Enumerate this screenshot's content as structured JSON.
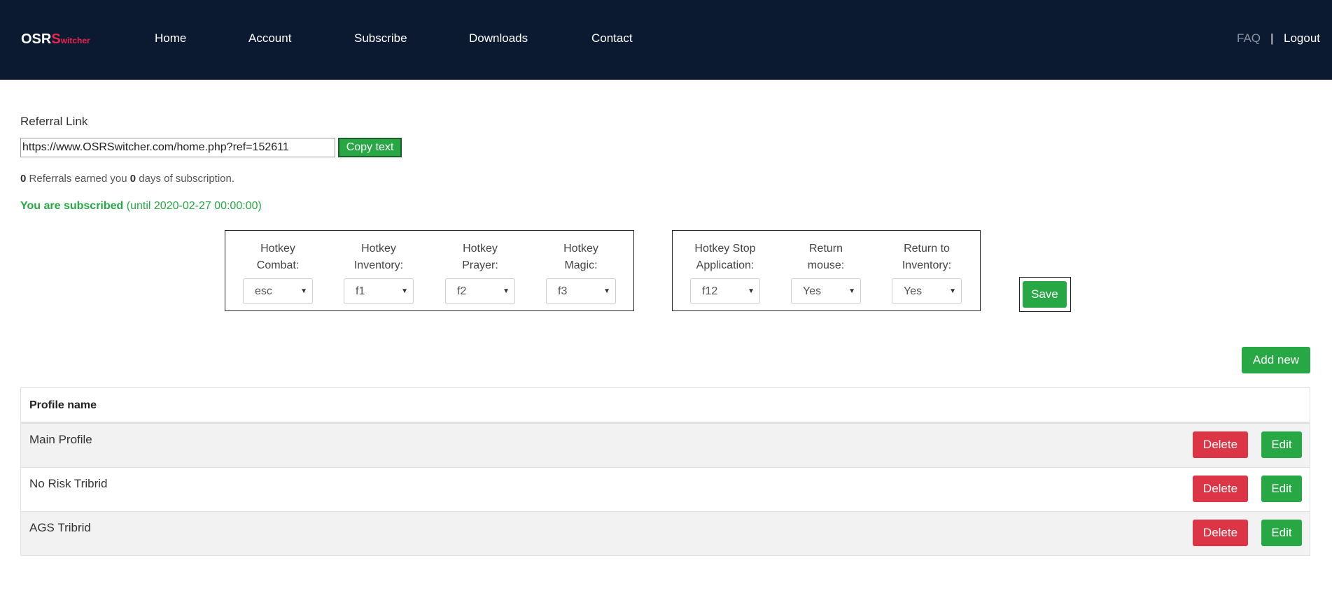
{
  "nav": {
    "logo_osr": "OSR",
    "logo_s": "S",
    "logo_witcher": "witcher",
    "links": [
      "Home",
      "Account",
      "Subscribe",
      "Downloads",
      "Contact"
    ],
    "faq": "FAQ",
    "separator": "|",
    "logout": "Logout"
  },
  "referral": {
    "label": "Referral Link",
    "link_value": "https://www.OSRSwitcher.com/home.php?ref=152611",
    "copy_label": "Copy text",
    "count": "0",
    "earned_text": "Referrals earned you",
    "days": "0",
    "days_text": "days of subscription."
  },
  "subscription": {
    "status": "You are subscribed",
    "until": "(until 2020-02-27 00:00:00)"
  },
  "hotkeys_group1": [
    {
      "line1": "Hotkey",
      "line2": "Combat:",
      "value": "esc"
    },
    {
      "line1": "Hotkey",
      "line2": "Inventory:",
      "value": "f1"
    },
    {
      "line1": "Hotkey",
      "line2": "Prayer:",
      "value": "f2"
    },
    {
      "line1": "Hotkey",
      "line2": "Magic:",
      "value": "f3"
    }
  ],
  "hotkeys_group2": [
    {
      "line1": "Hotkey Stop",
      "line2": "Application:",
      "value": "f12"
    },
    {
      "line1": "Return",
      "line2": "mouse:",
      "value": "Yes"
    },
    {
      "line1": "Return to",
      "line2": "Inventory:",
      "value": "Yes"
    }
  ],
  "actions": {
    "save": "Save",
    "add_new": "Add new"
  },
  "table": {
    "header": "Profile name",
    "rows": [
      {
        "name": "Main Profile",
        "delete": "Delete",
        "edit": "Edit"
      },
      {
        "name": "No Risk Tribrid",
        "delete": "Delete",
        "edit": "Edit"
      },
      {
        "name": "AGS Tribrid",
        "delete": "Delete",
        "edit": "Edit"
      }
    ]
  },
  "colors": {
    "navbar": "#0b1a30",
    "brand_accent": "#e8254f",
    "success": "#28a745",
    "danger": "#dc3545"
  }
}
